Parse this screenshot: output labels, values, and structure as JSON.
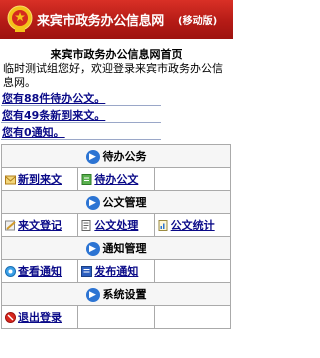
{
  "header": {
    "title": "来宾市政务办公信息网",
    "subtitle": "(移动版)",
    "emblem": "national-emblem-icon"
  },
  "page_title": "来宾市政务办公信息网首页",
  "greeting": "临时测试组您好，欢迎登录来宾市政务办公信息网。",
  "notices": [
    "您有88件待办公文。",
    "您有49条新到来文。",
    "您有0通知。"
  ],
  "sections": {
    "pending": {
      "title": "待办公务",
      "items": [
        {
          "label": "新到来文",
          "icon": "inbox-icon"
        },
        {
          "label": "待办公文",
          "icon": "pending-doc-icon"
        }
      ]
    },
    "docs": {
      "title": "公文管理",
      "items": [
        {
          "label": "来文登记",
          "icon": "register-icon"
        },
        {
          "label": "公文处理",
          "icon": "edit-doc-icon"
        },
        {
          "label": "公文统计",
          "icon": "stats-icon"
        }
      ]
    },
    "notify": {
      "title": "通知管理",
      "items": [
        {
          "label": "查看通知",
          "icon": "view-notice-icon"
        },
        {
          "label": "发布通知",
          "icon": "publish-notice-icon"
        }
      ]
    },
    "system": {
      "title": "系统设置",
      "items": [
        {
          "label": "退出登录",
          "icon": "logout-icon"
        }
      ]
    }
  },
  "colors": {
    "header": "#c4211b",
    "link": "#0a0a88",
    "section_arrow": "#2c74d3"
  }
}
